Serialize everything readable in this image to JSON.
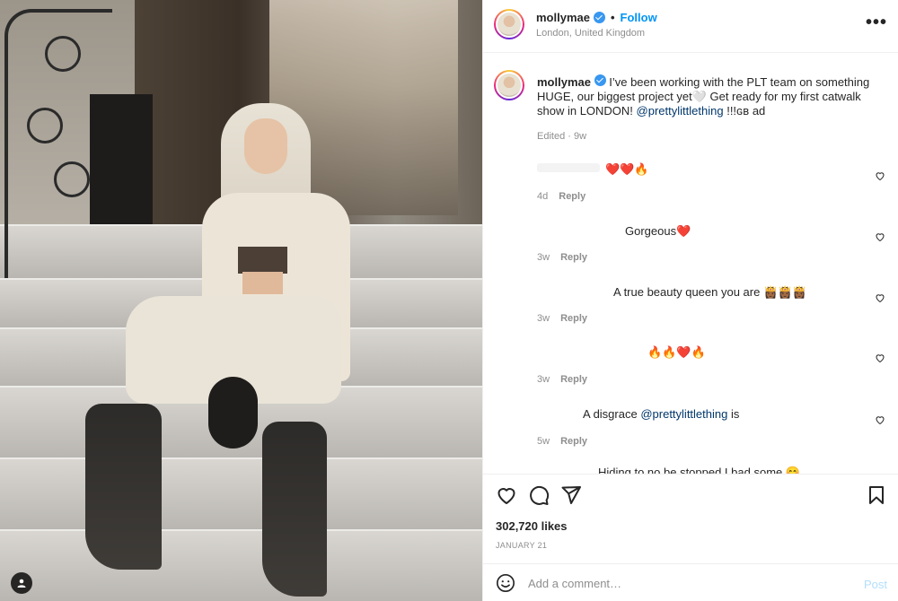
{
  "header": {
    "username": "mollymae",
    "follow_label": "Follow",
    "separator": "•",
    "location": "London, United Kingdom",
    "more_icon": "more-horizontal-icon"
  },
  "caption": {
    "username": "mollymae",
    "text_before_mention": "I’ve been working with the PLT team on something HUGE, our biggest project yet🤍 Get ready for my first catwalk show in LONDON!",
    "mention": "@prettylittlething",
    "text_after_mention": "!!!ɢʙ ad",
    "meta": "Edited · 9w"
  },
  "comments": [
    {
      "text": "❤️❤️🔥",
      "time": "4d",
      "reply": "Reply"
    },
    {
      "text": "Gorgeous❤️",
      "time": "3w",
      "reply": "Reply"
    },
    {
      "text": "A true beauty queen you are 👸🏾👸🏾👸🏾",
      "time": "3w",
      "reply": "Reply"
    },
    {
      "text": "🔥🔥❤️🔥",
      "time": "3w",
      "reply": "Reply"
    },
    {
      "text_before": "A disgrace",
      "mention": "@prettylittlething",
      "text_after": "is",
      "time": "5w",
      "reply": "Reply"
    },
    {
      "text": "Hiding to no be stopped I bad some 😊",
      "time": "",
      "reply": ""
    }
  ],
  "likes": "302,720 likes",
  "date": "JANUARY 21",
  "add_comment": {
    "placeholder": "Add a comment…",
    "post_label": "Post"
  },
  "colors": {
    "link": "#0095f6",
    "mention": "#00376b",
    "muted": "#8e8e8e",
    "text": "#262626",
    "post_disabled": "#b2dffc"
  }
}
